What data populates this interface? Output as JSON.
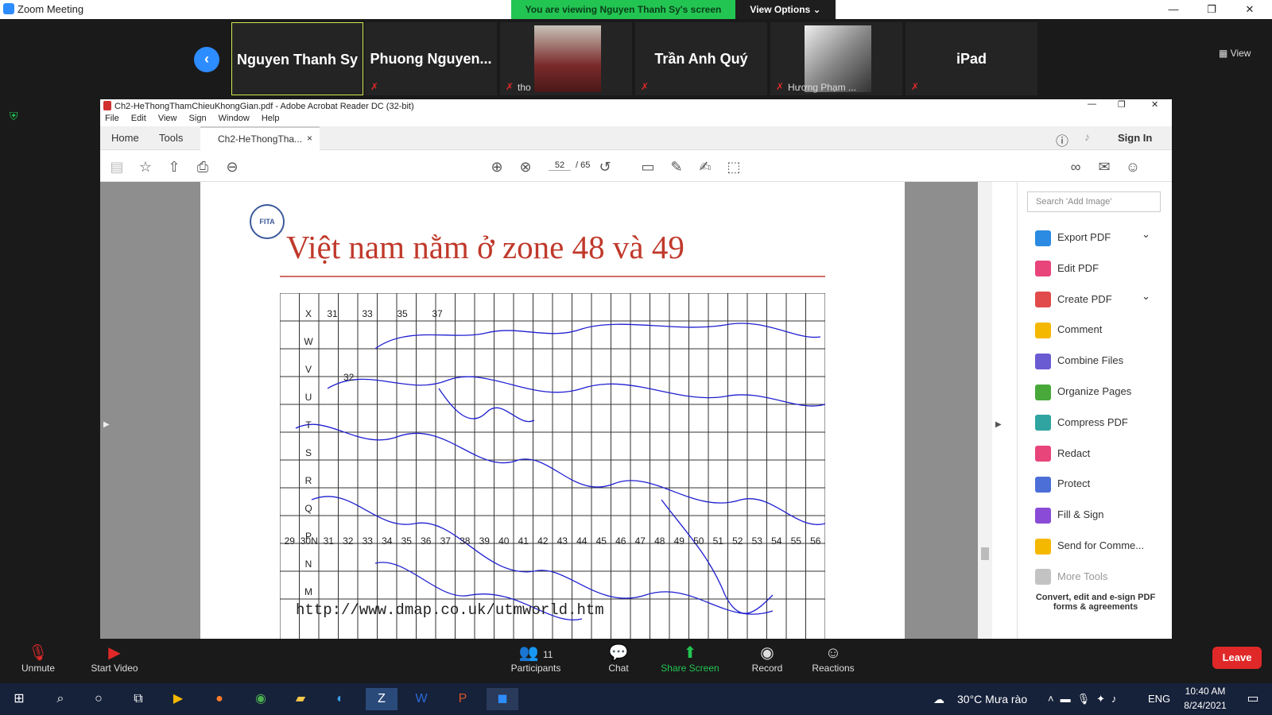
{
  "zoom": {
    "title": "Zoom Meeting",
    "banner": "You are viewing Nguyen Thanh Sy's screen",
    "view_options": "View Options ⌄",
    "gallery_view": "View",
    "participants": [
      {
        "label": "Nguyen Thanh Sy",
        "sub": ""
      },
      {
        "label": "Phuong  Nguyen...",
        "sub": ""
      },
      {
        "label": "",
        "sub": "tho"
      },
      {
        "label": "Trần Anh Quý",
        "sub": ""
      },
      {
        "label": "",
        "sub": "Hương Phạm ..."
      },
      {
        "label": "iPad",
        "sub": ""
      }
    ],
    "bottom": {
      "unmute": "Unmute",
      "start_video": "Start Video",
      "participants": "Participants",
      "participants_count": "11",
      "chat": "Chat",
      "share_screen": "Share Screen",
      "record": "Record",
      "reactions": "Reactions",
      "leave": "Leave"
    }
  },
  "acrobat": {
    "title": "Ch2-HeThongThamChieuKhongGian.pdf - Adobe Acrobat Reader DC (32-bit)",
    "menu": [
      "File",
      "Edit",
      "View",
      "Sign",
      "Window",
      "Help"
    ],
    "tabs": {
      "home": "Home",
      "tools": "Tools",
      "doc": "Ch2-HeThongTha..."
    },
    "sign_in": "Sign In",
    "page_current": "52",
    "page_total": "/ 65",
    "search_placeholder": "Search 'Add Image'",
    "tools": [
      {
        "label": "Export PDF",
        "color": "#2b8ae2"
      },
      {
        "label": "Edit PDF",
        "color": "#e8457a"
      },
      {
        "label": "Create PDF",
        "color": "#e24b4b"
      },
      {
        "label": "Comment",
        "color": "#f5b800"
      },
      {
        "label": "Combine Files",
        "color": "#6b5bd2"
      },
      {
        "label": "Organize Pages",
        "color": "#48a83a"
      },
      {
        "label": "Compress PDF",
        "color": "#2fa4a0"
      },
      {
        "label": "Redact",
        "color": "#e8457a"
      },
      {
        "label": "Protect",
        "color": "#4b6fd6"
      },
      {
        "label": "Fill & Sign",
        "color": "#8a4bd6"
      },
      {
        "label": "Send for Comme...",
        "color": "#f5b800"
      },
      {
        "label": "More Tools",
        "color": "#888888"
      }
    ],
    "promo": "Convert, edit and e-sign PDF forms & agreements"
  },
  "slide": {
    "logo_text": "FITA",
    "title": "Việt nam nằm ở zone 48 và 49",
    "grid_letters": [
      "X",
      "W",
      "V",
      "U",
      "T",
      "S",
      "R",
      "Q",
      "P",
      "N",
      "M"
    ],
    "top_zone_labels": [
      "31",
      "33",
      "35",
      "37"
    ],
    "inner_zone_label": "32",
    "bottom_zone_labels": [
      "29",
      "30N",
      "31",
      "32",
      "33",
      "34",
      "35",
      "36",
      "37",
      "38",
      "39",
      "40",
      "41",
      "42",
      "43",
      "44",
      "45",
      "46",
      "47",
      "48",
      "49",
      "50",
      "51",
      "52",
      "53",
      "54",
      "55",
      "56"
    ],
    "url": "http://www.dmap.co.uk/utmworld.htm"
  },
  "taskbar": {
    "weather": "30°C  Mưa rào",
    "lang": "ENG",
    "time": "10:40 AM",
    "date": "8/24/2021"
  }
}
